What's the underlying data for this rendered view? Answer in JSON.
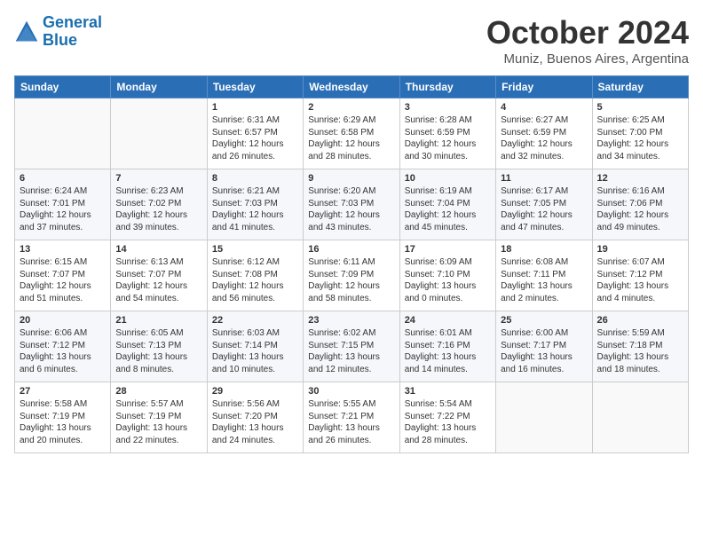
{
  "logo": {
    "line1": "General",
    "line2": "Blue"
  },
  "month": "October 2024",
  "location": "Muniz, Buenos Aires, Argentina",
  "days_header": [
    "Sunday",
    "Monday",
    "Tuesday",
    "Wednesday",
    "Thursday",
    "Friday",
    "Saturday"
  ],
  "weeks": [
    [
      {
        "day": "",
        "detail": ""
      },
      {
        "day": "",
        "detail": ""
      },
      {
        "day": "1",
        "detail": "Sunrise: 6:31 AM\nSunset: 6:57 PM\nDaylight: 12 hours\nand 26 minutes."
      },
      {
        "day": "2",
        "detail": "Sunrise: 6:29 AM\nSunset: 6:58 PM\nDaylight: 12 hours\nand 28 minutes."
      },
      {
        "day": "3",
        "detail": "Sunrise: 6:28 AM\nSunset: 6:59 PM\nDaylight: 12 hours\nand 30 minutes."
      },
      {
        "day": "4",
        "detail": "Sunrise: 6:27 AM\nSunset: 6:59 PM\nDaylight: 12 hours\nand 32 minutes."
      },
      {
        "day": "5",
        "detail": "Sunrise: 6:25 AM\nSunset: 7:00 PM\nDaylight: 12 hours\nand 34 minutes."
      }
    ],
    [
      {
        "day": "6",
        "detail": "Sunrise: 6:24 AM\nSunset: 7:01 PM\nDaylight: 12 hours\nand 37 minutes."
      },
      {
        "day": "7",
        "detail": "Sunrise: 6:23 AM\nSunset: 7:02 PM\nDaylight: 12 hours\nand 39 minutes."
      },
      {
        "day": "8",
        "detail": "Sunrise: 6:21 AM\nSunset: 7:03 PM\nDaylight: 12 hours\nand 41 minutes."
      },
      {
        "day": "9",
        "detail": "Sunrise: 6:20 AM\nSunset: 7:03 PM\nDaylight: 12 hours\nand 43 minutes."
      },
      {
        "day": "10",
        "detail": "Sunrise: 6:19 AM\nSunset: 7:04 PM\nDaylight: 12 hours\nand 45 minutes."
      },
      {
        "day": "11",
        "detail": "Sunrise: 6:17 AM\nSunset: 7:05 PM\nDaylight: 12 hours\nand 47 minutes."
      },
      {
        "day": "12",
        "detail": "Sunrise: 6:16 AM\nSunset: 7:06 PM\nDaylight: 12 hours\nand 49 minutes."
      }
    ],
    [
      {
        "day": "13",
        "detail": "Sunrise: 6:15 AM\nSunset: 7:07 PM\nDaylight: 12 hours\nand 51 minutes."
      },
      {
        "day": "14",
        "detail": "Sunrise: 6:13 AM\nSunset: 7:07 PM\nDaylight: 12 hours\nand 54 minutes."
      },
      {
        "day": "15",
        "detail": "Sunrise: 6:12 AM\nSunset: 7:08 PM\nDaylight: 12 hours\nand 56 minutes."
      },
      {
        "day": "16",
        "detail": "Sunrise: 6:11 AM\nSunset: 7:09 PM\nDaylight: 12 hours\nand 58 minutes."
      },
      {
        "day": "17",
        "detail": "Sunrise: 6:09 AM\nSunset: 7:10 PM\nDaylight: 13 hours\nand 0 minutes."
      },
      {
        "day": "18",
        "detail": "Sunrise: 6:08 AM\nSunset: 7:11 PM\nDaylight: 13 hours\nand 2 minutes."
      },
      {
        "day": "19",
        "detail": "Sunrise: 6:07 AM\nSunset: 7:12 PM\nDaylight: 13 hours\nand 4 minutes."
      }
    ],
    [
      {
        "day": "20",
        "detail": "Sunrise: 6:06 AM\nSunset: 7:12 PM\nDaylight: 13 hours\nand 6 minutes."
      },
      {
        "day": "21",
        "detail": "Sunrise: 6:05 AM\nSunset: 7:13 PM\nDaylight: 13 hours\nand 8 minutes."
      },
      {
        "day": "22",
        "detail": "Sunrise: 6:03 AM\nSunset: 7:14 PM\nDaylight: 13 hours\nand 10 minutes."
      },
      {
        "day": "23",
        "detail": "Sunrise: 6:02 AM\nSunset: 7:15 PM\nDaylight: 13 hours\nand 12 minutes."
      },
      {
        "day": "24",
        "detail": "Sunrise: 6:01 AM\nSunset: 7:16 PM\nDaylight: 13 hours\nand 14 minutes."
      },
      {
        "day": "25",
        "detail": "Sunrise: 6:00 AM\nSunset: 7:17 PM\nDaylight: 13 hours\nand 16 minutes."
      },
      {
        "day": "26",
        "detail": "Sunrise: 5:59 AM\nSunset: 7:18 PM\nDaylight: 13 hours\nand 18 minutes."
      }
    ],
    [
      {
        "day": "27",
        "detail": "Sunrise: 5:58 AM\nSunset: 7:19 PM\nDaylight: 13 hours\nand 20 minutes."
      },
      {
        "day": "28",
        "detail": "Sunrise: 5:57 AM\nSunset: 7:19 PM\nDaylight: 13 hours\nand 22 minutes."
      },
      {
        "day": "29",
        "detail": "Sunrise: 5:56 AM\nSunset: 7:20 PM\nDaylight: 13 hours\nand 24 minutes."
      },
      {
        "day": "30",
        "detail": "Sunrise: 5:55 AM\nSunset: 7:21 PM\nDaylight: 13 hours\nand 26 minutes."
      },
      {
        "day": "31",
        "detail": "Sunrise: 5:54 AM\nSunset: 7:22 PM\nDaylight: 13 hours\nand 28 minutes."
      },
      {
        "day": "",
        "detail": ""
      },
      {
        "day": "",
        "detail": ""
      }
    ]
  ]
}
